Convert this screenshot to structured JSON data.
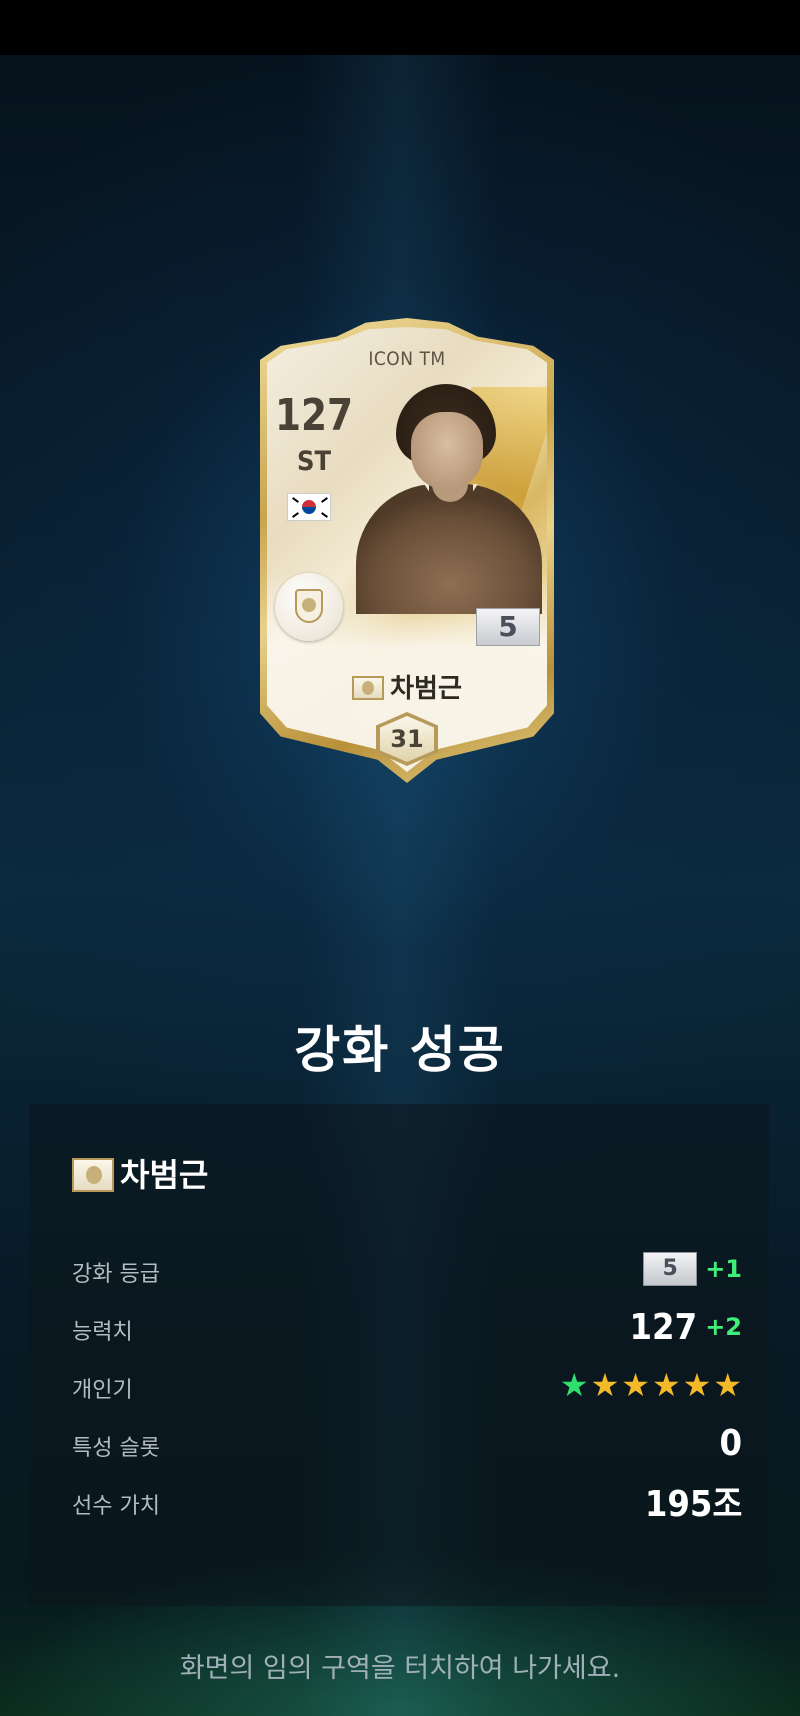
{
  "card": {
    "title": "ICON TM",
    "overall": "127",
    "position": "ST",
    "nationality_flag": "south-korea-flag-icon",
    "grade": "5",
    "player_name": "차범근",
    "salary": "31"
  },
  "result": {
    "title": "강화 성공",
    "player_name": "차범근",
    "stats": [
      {
        "label": "강화 등급",
        "value": "5",
        "delta": "+1"
      },
      {
        "label": "능력치",
        "value": "127",
        "delta": "+2"
      },
      {
        "label": "개인기",
        "stars_total": 6,
        "stars_highlighted": 1
      },
      {
        "label": "특성 슬롯",
        "value": "0"
      },
      {
        "label": "선수 가치",
        "value": "195조"
      }
    ]
  },
  "colors": {
    "gold": "#c9a44c",
    "delta_green": "#3ef07a",
    "star_gold": "#f3b928",
    "star_green": "#2fe06e"
  },
  "hint": "화면의 임의 구역을 터치하여 나가세요."
}
